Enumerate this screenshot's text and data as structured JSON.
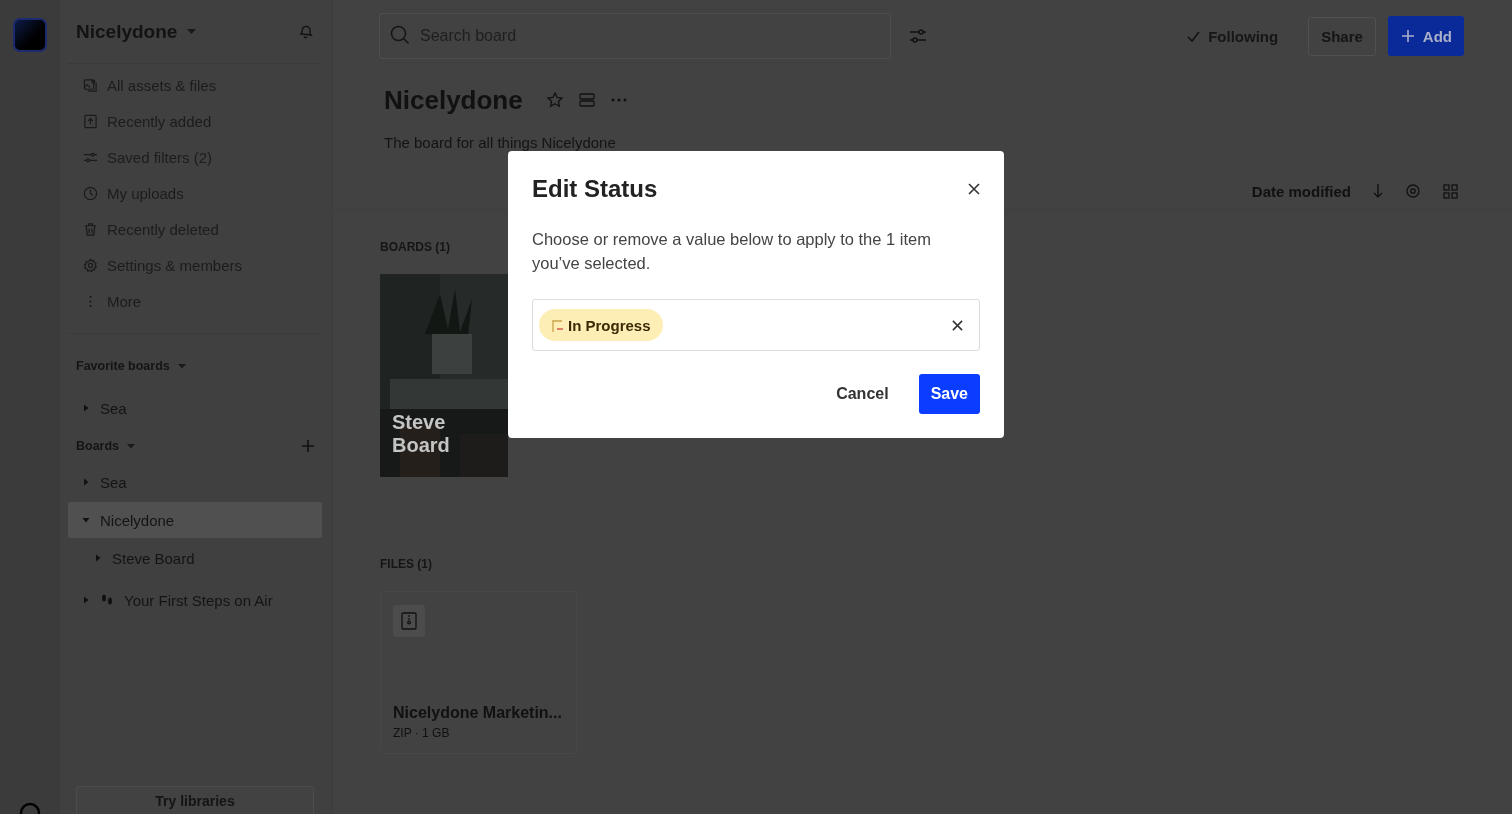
{
  "workspace": {
    "name": "Nicelydone"
  },
  "nav": [
    {
      "label": "All assets & files"
    },
    {
      "label": "Recently added"
    },
    {
      "label": "Saved filters (2)"
    },
    {
      "label": "My uploads"
    },
    {
      "label": "Recently deleted"
    },
    {
      "label": "Settings & members"
    },
    {
      "label": "More"
    }
  ],
  "favorite_boards": {
    "title": "Favorite boards",
    "items": [
      {
        "label": "Sea",
        "kind": "board",
        "expanded": false,
        "selected": false
      }
    ]
  },
  "boards": {
    "title": "Boards",
    "items": [
      {
        "label": "Sea",
        "kind": "board",
        "expanded": false,
        "selected": false
      },
      {
        "label": "Nicelydone",
        "kind": "board",
        "expanded": true,
        "selected": true,
        "children": [
          {
            "label": "Steve Board",
            "kind": "board",
            "expanded": false,
            "selected": false
          }
        ]
      },
      {
        "label": "Your First Steps on Air",
        "kind": "guide",
        "expanded": false,
        "selected": false
      }
    ]
  },
  "try_button": "Try libraries",
  "search": {
    "placeholder": "Search board"
  },
  "following": {
    "label": "Following",
    "checked": true
  },
  "share_button": "Share",
  "add_button": "Add",
  "board": {
    "title": "Nicelydone",
    "description": "The board for all things Nicelydone"
  },
  "sort": {
    "label": "Date modified"
  },
  "boards_section": {
    "heading": "BOARDS (1)",
    "cards": [
      {
        "title": "Steve Board",
        "kind": "picture"
      }
    ]
  },
  "files_section": {
    "heading": "FILES (1)",
    "files": [
      {
        "name": "Nicelydone Marketin...",
        "meta": "ZIP · 1 GB"
      }
    ]
  },
  "dialog": {
    "title": "Edit Status",
    "message": "Choose or remove a value below to apply to the 1 item you’ve selected.",
    "value": {
      "label": "In Progress"
    },
    "buttons": [
      "Cancel",
      "Save"
    ]
  }
}
